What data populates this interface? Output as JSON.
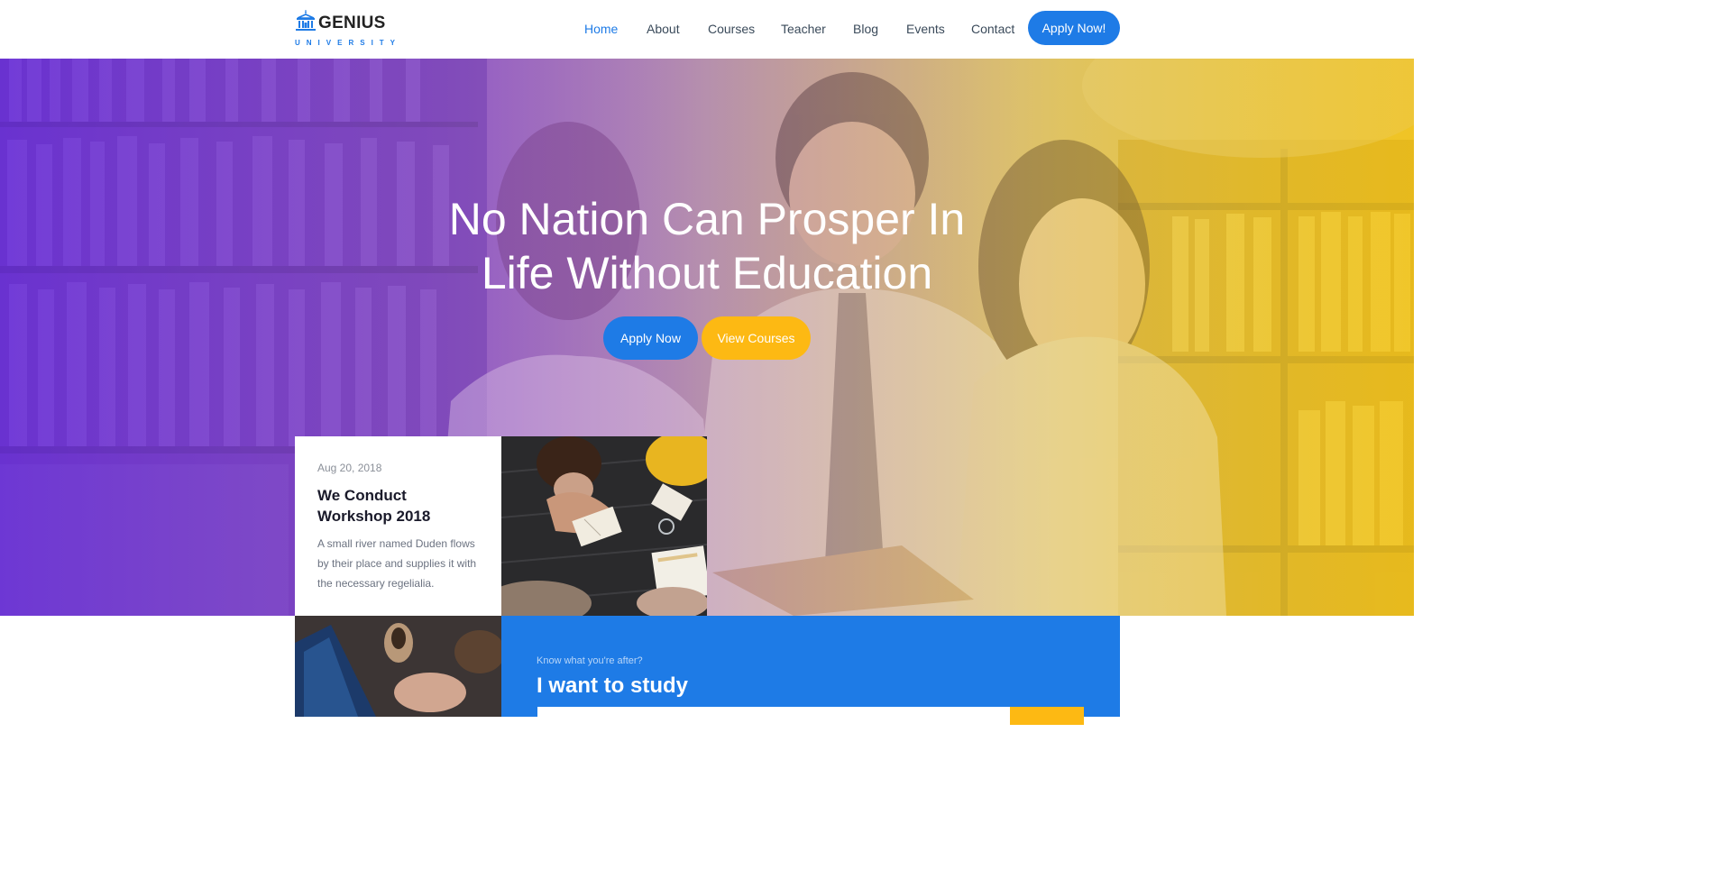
{
  "brand": {
    "name": "GENIUS",
    "tagline": "UNIVERSITY",
    "logo_icon": "university-building-icon",
    "accent": "#1e7be6",
    "secondary": "#fdb913"
  },
  "nav": {
    "items": [
      {
        "label": "Home",
        "active": true
      },
      {
        "label": "About"
      },
      {
        "label": "Courses"
      },
      {
        "label": "Teacher"
      },
      {
        "label": "Blog"
      },
      {
        "label": "Events"
      },
      {
        "label": "Contact"
      }
    ],
    "cta": "Apply Now!"
  },
  "hero": {
    "title_line1": "No Nation Can Prosper In",
    "title_line2": "Life Without Education",
    "primary_button": "Apply Now",
    "secondary_button": "View Courses"
  },
  "event": {
    "date": "Aug 20, 2018",
    "title": "We Conduct Workshop 2018",
    "text": "A small river named Duden flows by their place and supplies it with the necessary regelialia."
  },
  "study": {
    "kicker": "Know what you're after?",
    "title": "I want to study"
  }
}
